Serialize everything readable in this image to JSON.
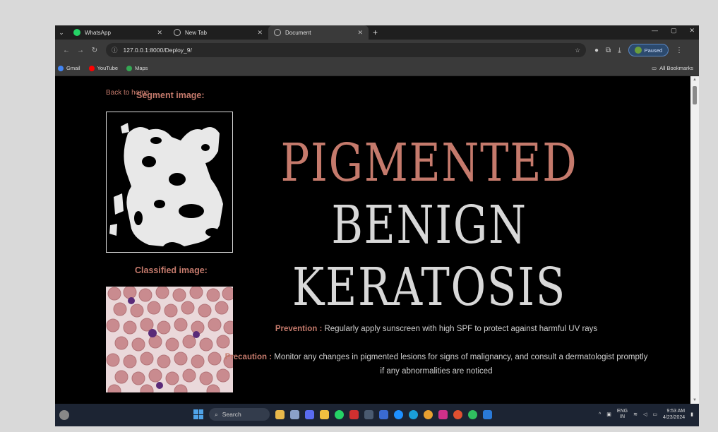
{
  "browser": {
    "tabs": [
      {
        "title": "WhatsApp",
        "icon": "whatsapp-icon",
        "active": false,
        "icon_color": "#25d366"
      },
      {
        "title": "New Tab",
        "icon": "chrome-icon",
        "active": false,
        "icon_color": "#bbbbbb"
      },
      {
        "title": "Document",
        "icon": "globe-icon",
        "active": true,
        "icon_color": "#bbbbbb"
      }
    ],
    "url": "127.0.0.1:8000/Deploy_9/",
    "profile_status": "Paused",
    "bookmarks": [
      {
        "label": "Gmail",
        "icon": "google-icon",
        "color": "#4285f4"
      },
      {
        "label": "YouTube",
        "icon": "youtube-icon",
        "color": "#ff0000"
      },
      {
        "label": "Maps",
        "icon": "maps-icon",
        "color": "#34a853"
      }
    ],
    "all_bookmarks": "All Bookmarks"
  },
  "page": {
    "back_link": "Back to home",
    "segment_title": "Segment image:",
    "classified_title": "Classified image:",
    "headline_line1": "PIGMENTED",
    "headline_line2": "BENIGN",
    "headline_line3": "KERATOSIS",
    "prevention_label": "Prevention :",
    "prevention_text": " Regularly apply sunscreen with high SPF to protect against harmful UV rays",
    "precaution_label": "Precaution :",
    "precaution_text": " Monitor any changes in pigmented lesions for signs of malignancy, and consult a dermatologist promptly if any abnormalities are noticed",
    "accent_color": "#c57a6c"
  },
  "taskbar": {
    "search_placeholder": "Search",
    "language": "ENG",
    "region": "IN",
    "time": "9:53 AM",
    "date": "4/23/2024"
  }
}
